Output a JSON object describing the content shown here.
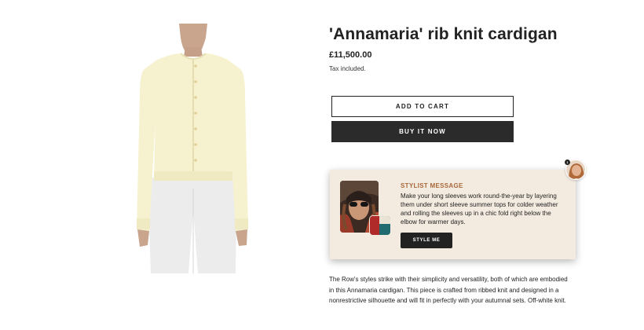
{
  "product": {
    "title": "'Annamaria' rib knit cardigan",
    "price": "£11,500.00",
    "tax_note": "Tax included.",
    "description": "The Row's styles strike with their simplicity and versatility, both of which are embodied in this Annamaria cardigan. This piece is crafted from ribbed knit and designed in a nonrestrictive silhouette and will fit in perfectly with your autumnal sets. Off-white knit."
  },
  "actions": {
    "add_to_cart": "ADD TO CART",
    "buy_it_now": "BUY IT NOW"
  },
  "stylist": {
    "heading": "STYLIST MESSAGE",
    "message": "Make your long sleeves work round-the-year by layering them under short sleeve summer tops for colder weather and rolling the sleeves up in a chic fold right below the elbow for warmer days.",
    "button": "STYLE ME",
    "badge_count": "1"
  },
  "colors": {
    "cardigan": "#f6f2cf",
    "trousers": "#ececec",
    "card_bg": "#f4ebe0",
    "heading_accent": "#a8683a",
    "buy_button": "#2b2b2b"
  }
}
